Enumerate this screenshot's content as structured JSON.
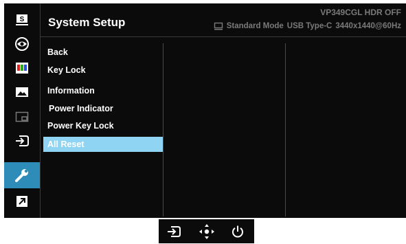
{
  "header": {
    "title": "System Setup",
    "model": "VP349CGL HDR OFF",
    "mode": "Standard Mode",
    "input": "USB Type-C",
    "resolution": "3440x1440@60Hz"
  },
  "sidebar": {
    "items": [
      {
        "icon": "splendid-icon",
        "glyph": "S"
      },
      {
        "icon": "eye-care-icon"
      },
      {
        "icon": "color-icon"
      },
      {
        "icon": "image-icon"
      },
      {
        "icon": "pip-icon"
      },
      {
        "icon": "input-select-icon"
      },
      {
        "icon": "system-setup-icon",
        "active": true
      },
      {
        "icon": "shortcut-icon"
      }
    ]
  },
  "menu": {
    "items": [
      "Back",
      "Key Lock",
      "Information",
      "Power Indicator",
      "Power Key Lock",
      "All Reset"
    ],
    "selected": "All Reset"
  },
  "keys": [
    {
      "icon": "input-icon"
    },
    {
      "icon": "five-way-navigator-icon"
    },
    {
      "icon": "power-icon"
    }
  ],
  "colors": {
    "background": "#0b0b0b",
    "active_tab": "#2d8db8",
    "selected_item": "#8fd4f2",
    "header_info": "#7a7a7a"
  }
}
